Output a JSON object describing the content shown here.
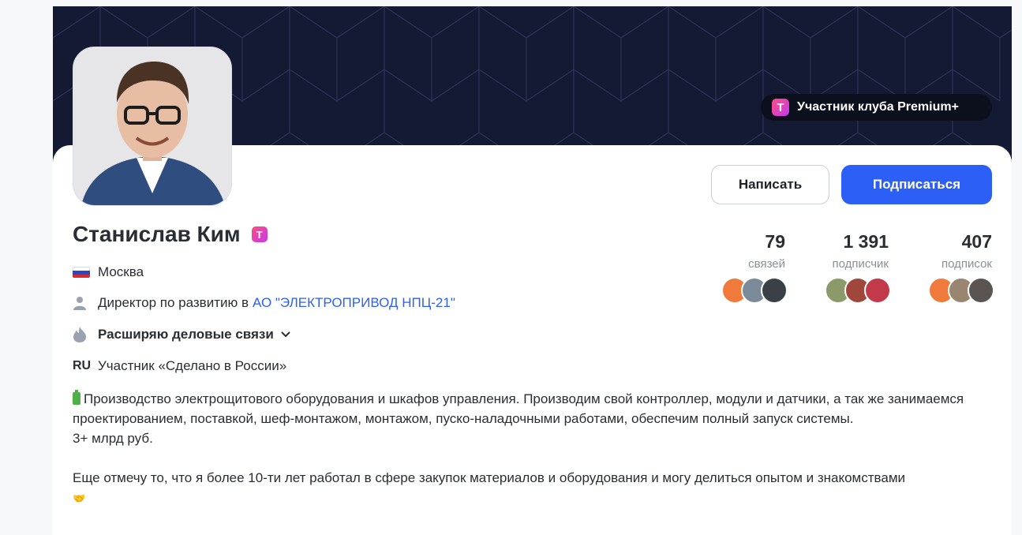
{
  "banner": {
    "premium_badge": "Участник клуба Premium+",
    "logo_letter": "T"
  },
  "profile": {
    "name": "Станислав Ким",
    "city": "Москва",
    "position": "Директор по развитию в",
    "company": "АО \"ЭЛЕКТРОПРИВОД НПЦ-21\"",
    "goal": "Расширяю деловые связи",
    "ru_badge": "RU",
    "membership": "Участник «Сделано в России»"
  },
  "actions": {
    "write_label": "Написать",
    "subscribe_label": "Подписаться"
  },
  "stats": [
    {
      "value": "79",
      "label": "связей"
    },
    {
      "value": "1 391",
      "label": "подписчик"
    },
    {
      "value": "407",
      "label": "подписок"
    }
  ],
  "about": {
    "line1": "Производство электрощитового оборудования и шкафов управления. Производим свой контроллер, модули и датчики, а так же занимаемся проектированием, поставкой, шеф-монтажом, монтажом, пуско-наладочными работами, обеспечим полный запуск системы.",
    "line2": "3+ млрд руб.",
    "line3": "Еще отмечу то, что я более 10-ти лет работал в сфере закупок материалов и оборудования и могу делиться опытом и знакомствами",
    "emoji": "🤝"
  },
  "colors": {
    "accent": "#2c5ff6",
    "banner": "#141a33",
    "link": "#2c5ff6"
  }
}
